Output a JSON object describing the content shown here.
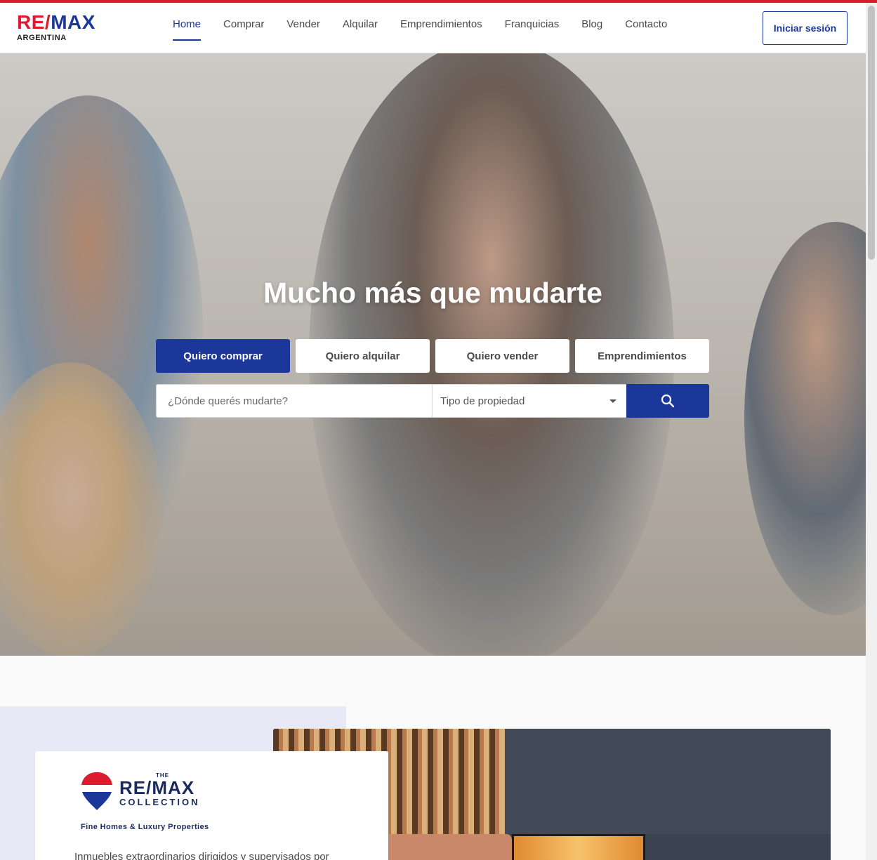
{
  "brand": {
    "logo_text_red": "RE/",
    "logo_text_blue": "MAX",
    "logo_subtitle": "ARGENTINA"
  },
  "nav": {
    "items": [
      {
        "label": "Home",
        "active": true
      },
      {
        "label": "Comprar",
        "active": false
      },
      {
        "label": "Vender",
        "active": false
      },
      {
        "label": "Alquilar",
        "active": false
      },
      {
        "label": "Emprendimientos",
        "active": false
      },
      {
        "label": "Franquicias",
        "active": false
      },
      {
        "label": "Blog",
        "active": false
      },
      {
        "label": "Contacto",
        "active": false
      }
    ],
    "login_label": "Iniciar sesión"
  },
  "hero": {
    "title": "Mucho más que mudarte",
    "tabs": [
      {
        "label": "Quiero comprar",
        "active": true
      },
      {
        "label": "Quiero alquilar",
        "active": false
      },
      {
        "label": "Quiero vender",
        "active": false
      },
      {
        "label": "Emprendimientos",
        "active": false
      }
    ],
    "search": {
      "placeholder": "¿Dónde querés mudarte?",
      "property_type_label": "Tipo de propiedad",
      "search_icon": "search-icon"
    }
  },
  "collection": {
    "the": "THE",
    "remax": "RE/MAX",
    "collection": "COLLECTION",
    "tagline": "Fine Homes & Luxury Properties",
    "description": "Inmuebles extraordinarios dirigidos y supervisados por"
  },
  "colors": {
    "brand_red": "#dc1c2e",
    "brand_blue": "#1a3799",
    "collection_navy": "#1a2a5c"
  }
}
